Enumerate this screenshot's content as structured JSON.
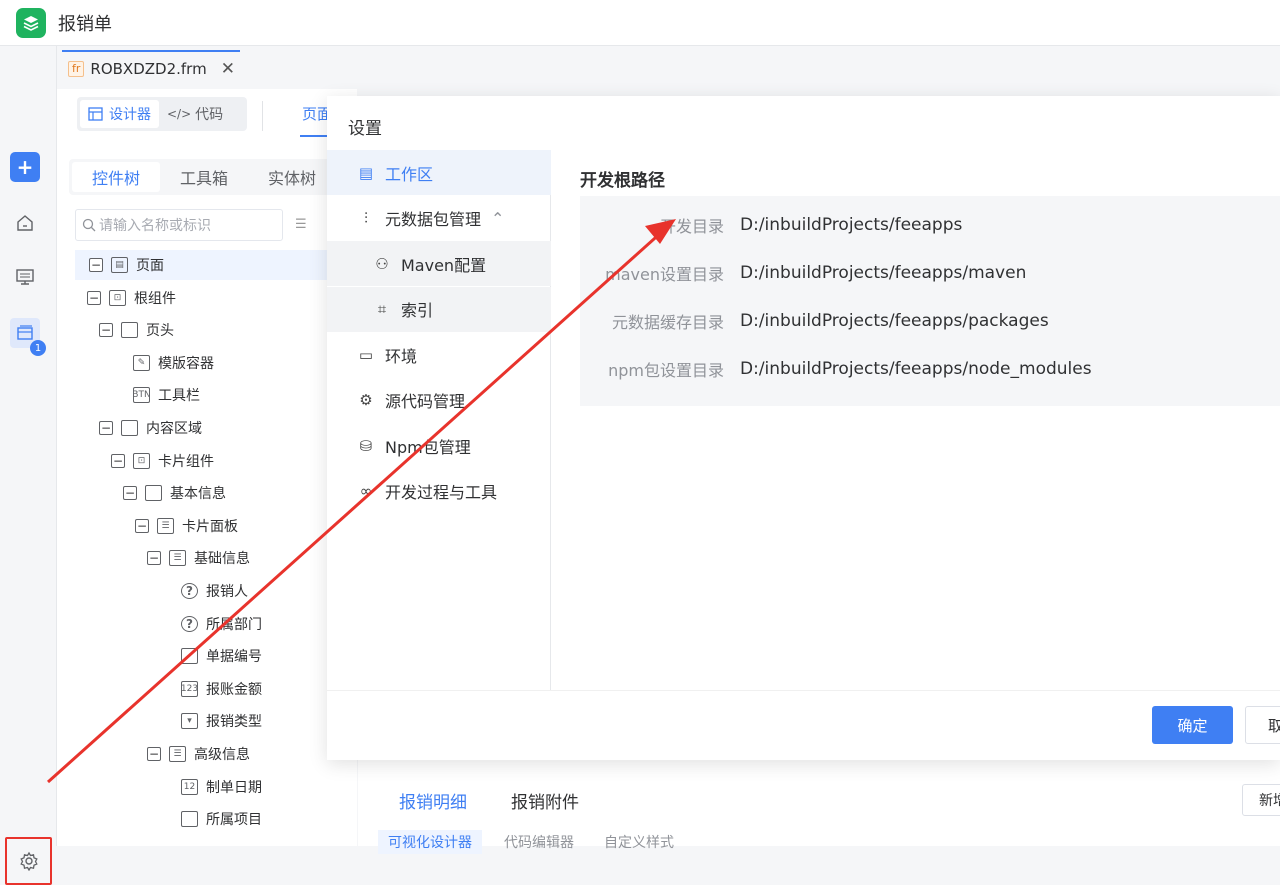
{
  "app": {
    "title": "报销单"
  },
  "file_tab": {
    "tag": "fr",
    "name": "ROBXDZD2.frm"
  },
  "editor": {
    "mode_designer": "设计器",
    "mode_code": "代码",
    "page_tab": "页面",
    "tree_tabs": [
      "控件树",
      "工具箱",
      "实体树"
    ],
    "search_placeholder": "请输入名称或标识"
  },
  "tree": [
    {
      "label": "页面",
      "depth": 0,
      "expand": true,
      "icon": "page-icon"
    },
    {
      "label": "根组件",
      "depth": 1,
      "expand": true,
      "icon": "component-icon"
    },
    {
      "label": "页头",
      "depth": 2,
      "expand": true,
      "icon": "frame-icon"
    },
    {
      "label": "模版容器",
      "depth": 3,
      "expand": false,
      "icon": "template-icon"
    },
    {
      "label": "工具栏",
      "depth": 3,
      "expand": false,
      "icon": "toolbar-icon"
    },
    {
      "label": "内容区域",
      "depth": 2,
      "expand": true,
      "icon": "frame-icon"
    },
    {
      "label": "卡片组件",
      "depth": 3,
      "expand": true,
      "icon": "component-icon"
    },
    {
      "label": "基本信息",
      "depth": 4,
      "expand": true,
      "icon": "section-icon"
    },
    {
      "label": "卡片面板",
      "depth": 5,
      "expand": true,
      "icon": "panel-icon"
    },
    {
      "label": "基础信息",
      "depth": 6,
      "expand": true,
      "icon": "panel-icon"
    },
    {
      "label": "报销人",
      "depth": 7,
      "expand": false,
      "icon": "help-icon"
    },
    {
      "label": "所属部门",
      "depth": 7,
      "expand": false,
      "icon": "help-icon"
    },
    {
      "label": "单据编号",
      "depth": 7,
      "expand": false,
      "icon": "textbox-icon"
    },
    {
      "label": "报账金额",
      "depth": 7,
      "expand": false,
      "icon": "number-icon"
    },
    {
      "label": "报销类型",
      "depth": 7,
      "expand": false,
      "icon": "dropdown-icon"
    },
    {
      "label": "高级信息",
      "depth": 6,
      "expand": true,
      "icon": "panel-icon"
    },
    {
      "label": "制单日期",
      "depth": 7,
      "expand": false,
      "icon": "date-icon"
    },
    {
      "label": "所属项目",
      "depth": 7,
      "expand": false,
      "icon": "textbox-icon"
    }
  ],
  "bottom": {
    "tabs": [
      "报销明细",
      "报销附件"
    ],
    "subtabs": [
      "可视化设计器",
      "代码编辑器",
      "自定义样式"
    ],
    "new_button": "新增"
  },
  "dialog": {
    "title": "设置",
    "nav": [
      {
        "label": "工作区",
        "icon": "workspace-icon",
        "active": true,
        "sub": false
      },
      {
        "label": "元数据包管理",
        "icon": "sliders-icon",
        "active": false,
        "sub": false,
        "chevron": "^"
      },
      {
        "label": "Maven配置",
        "icon": "share-icon",
        "active": false,
        "sub": true
      },
      {
        "label": "索引",
        "icon": "index-icon",
        "active": false,
        "sub": true
      },
      {
        "label": "环境",
        "icon": "environment-icon",
        "active": false,
        "sub": false
      },
      {
        "label": "源代码管理",
        "icon": "gear-icon",
        "active": false,
        "sub": false
      },
      {
        "label": "Npm包管理",
        "icon": "database-icon",
        "active": false,
        "sub": false
      },
      {
        "label": "开发过程与工具",
        "icon": "infinity-icon",
        "active": false,
        "sub": false
      }
    ],
    "section_title": "开发根路径",
    "rows": [
      {
        "label": "开发目录",
        "value": "D:/inbuildProjects/feeapps"
      },
      {
        "label": "maven设置目录",
        "value": "D:/inbuildProjects/feeapps/maven"
      },
      {
        "label": "元数据缓存目录",
        "value": "D:/inbuildProjects/feeapps/packages"
      },
      {
        "label": "npm包设置目录",
        "value": "D:/inbuildProjects/feeapps/node_modules"
      }
    ],
    "ok_label": "确定",
    "cancel_label": "取消"
  },
  "rail": {
    "badge": "1"
  },
  "colors": {
    "accent": "#3f7ff3",
    "annotation": "#e8332c",
    "logo": "#1fb35f"
  }
}
